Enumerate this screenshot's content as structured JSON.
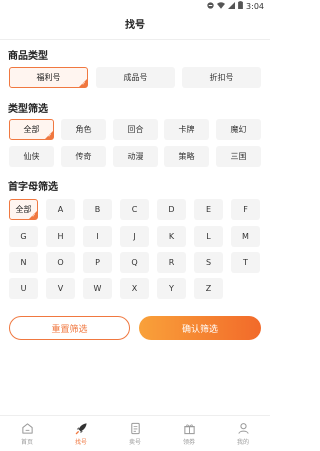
{
  "status_bar": {
    "time": "3:04"
  },
  "header": {
    "title": "找号"
  },
  "product_type": {
    "title": "商品类型",
    "options": [
      {
        "label": "福利号",
        "selected": true
      },
      {
        "label": "成品号",
        "selected": false
      },
      {
        "label": "折扣号",
        "selected": false
      }
    ]
  },
  "type_filter": {
    "title": "类型筛选",
    "options": [
      {
        "label": "全部",
        "selected": true
      },
      {
        "label": "角色",
        "selected": false
      },
      {
        "label": "回合",
        "selected": false
      },
      {
        "label": "卡牌",
        "selected": false
      },
      {
        "label": "魔幻",
        "selected": false
      },
      {
        "label": "仙侠",
        "selected": false
      },
      {
        "label": "传奇",
        "selected": false
      },
      {
        "label": "动漫",
        "selected": false
      },
      {
        "label": "策略",
        "selected": false
      },
      {
        "label": "三国",
        "selected": false
      }
    ]
  },
  "letter_filter": {
    "title": "首字母筛选",
    "options": [
      {
        "label": "全部",
        "selected": true
      },
      {
        "label": "A"
      },
      {
        "label": "B"
      },
      {
        "label": "C"
      },
      {
        "label": "D"
      },
      {
        "label": "E"
      },
      {
        "label": "F"
      },
      {
        "label": "G"
      },
      {
        "label": "H"
      },
      {
        "label": "I"
      },
      {
        "label": "J"
      },
      {
        "label": "K"
      },
      {
        "label": "L"
      },
      {
        "label": "M"
      },
      {
        "label": "N"
      },
      {
        "label": "O"
      },
      {
        "label": "P"
      },
      {
        "label": "Q"
      },
      {
        "label": "R"
      },
      {
        "label": "S"
      },
      {
        "label": "T"
      },
      {
        "label": "U"
      },
      {
        "label": "V"
      },
      {
        "label": "W"
      },
      {
        "label": "X"
      },
      {
        "label": "Y"
      },
      {
        "label": "Z"
      }
    ]
  },
  "actions": {
    "reset_label": "重置筛选",
    "confirm_label": "确认筛选"
  },
  "tabbar": {
    "items": [
      {
        "label": "首页",
        "icon": "home-icon",
        "active": false
      },
      {
        "label": "找号",
        "icon": "rocket-icon",
        "active": true
      },
      {
        "label": "卖号",
        "icon": "document-icon",
        "active": false
      },
      {
        "label": "领券",
        "icon": "gift-icon",
        "active": false
      },
      {
        "label": "我的",
        "icon": "user-icon",
        "active": false
      }
    ]
  },
  "colors": {
    "accent": "#f07840",
    "accent_light": "#fff5f0",
    "chip_bg": "#f4f4f4"
  }
}
